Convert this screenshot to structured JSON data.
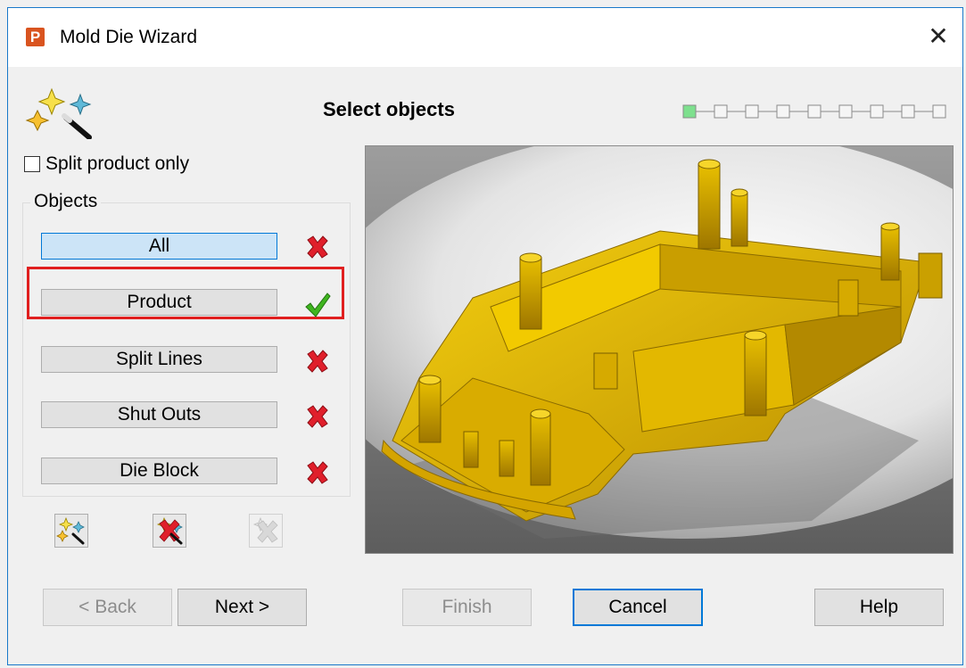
{
  "window": {
    "app_icon_letter": "P",
    "title": "Mold Die Wizard",
    "close_glyph": "✕"
  },
  "header": {
    "step_title": "Select objects",
    "progress_total_steps": 9,
    "progress_current_step": 1,
    "progress_active_color": "#7ee08e"
  },
  "options": {
    "split_product_only_label": "Split product only",
    "split_product_only_checked": false
  },
  "objects": {
    "group_label": "Objects",
    "items": [
      {
        "label": "All",
        "status": "cross-icon",
        "selected": true
      },
      {
        "label": "Product",
        "status": "check-icon",
        "selected": false
      },
      {
        "label": "Split Lines",
        "status": "cross-icon",
        "selected": false
      },
      {
        "label": "Shut Outs",
        "status": "cross-icon",
        "selected": false
      },
      {
        "label": "Die Block",
        "status": "cross-icon",
        "selected": false
      }
    ]
  },
  "tools": [
    {
      "name": "wizard-add-icon",
      "enabled": true
    },
    {
      "name": "wizard-edit-icon",
      "enabled": true
    },
    {
      "name": "wizard-delete-icon",
      "enabled": false
    }
  ],
  "preview": {
    "subject": "yellow plastic product part 3D render",
    "part_color": "#e1b400"
  },
  "footer": {
    "back": "< Back",
    "next": "Next >",
    "finish": "Finish",
    "cancel": "Cancel",
    "help": "Help"
  },
  "colors": {
    "accent": "#0078d7",
    "highlight_border": "#e01f1f",
    "cross": "#e01f2b",
    "check": "#3fb51f"
  }
}
